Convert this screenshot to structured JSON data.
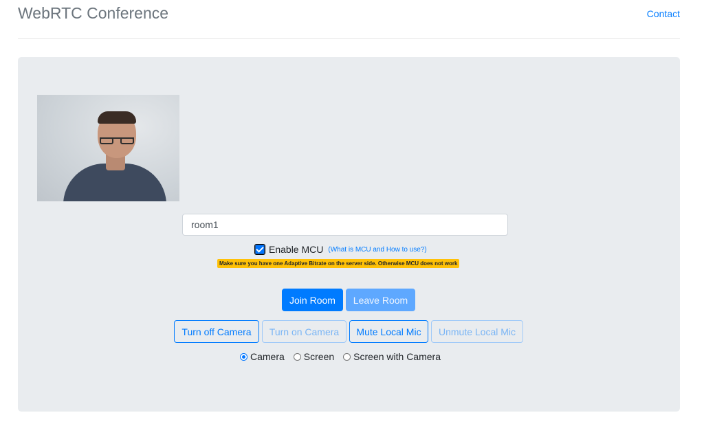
{
  "header": {
    "brand": "WebRTC Conference",
    "contact_label": "Contact"
  },
  "room": {
    "value": "room1"
  },
  "mcu": {
    "checked": true,
    "label": "Enable MCU",
    "link_label": "(What is MCU and How to use?)",
    "warning": "Make sure you have one Adaptive Bitrate on the server side. Otherwise MCU does not work"
  },
  "buttons": {
    "join": "Join Room",
    "leave": "Leave Room",
    "turn_off_camera": "Turn off Camera",
    "turn_on_camera": "Turn on Camera",
    "mute_mic": "Mute Local Mic",
    "unmute_mic": "Unmute Local Mic"
  },
  "source_options": [
    {
      "label": "Camera",
      "checked": true
    },
    {
      "label": "Screen",
      "checked": false
    },
    {
      "label": "Screen with Camera",
      "checked": false
    }
  ],
  "colors": {
    "primary": "#007bff",
    "warning": "#ffc107",
    "panel": "#e9ecef"
  }
}
